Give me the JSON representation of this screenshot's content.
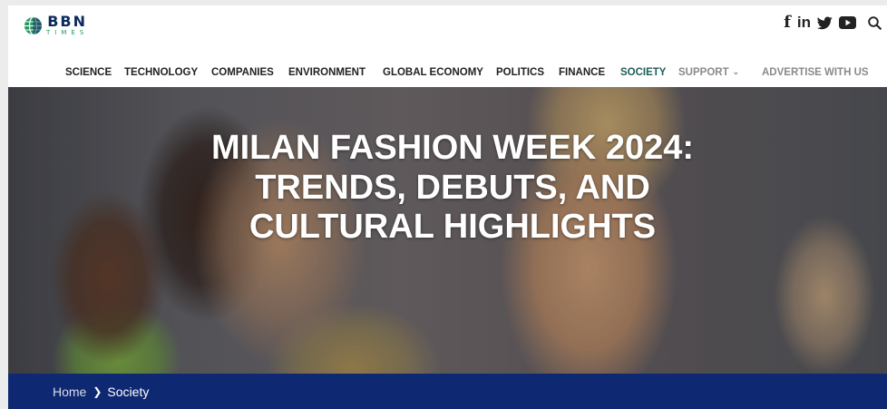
{
  "brand": {
    "logo_main": "BBN",
    "logo_sub": "TIMES",
    "colors": {
      "navy": "#0d2a5e",
      "green": "#1f9a5c"
    }
  },
  "social_icons": [
    "facebook-icon",
    "linkedin-icon",
    "twitter-icon",
    "youtube-icon",
    "search-icon"
  ],
  "social_glyphs": {
    "facebook": "f",
    "linkedin": "in"
  },
  "nav": {
    "items": [
      {
        "label": "SCIENCE"
      },
      {
        "label": "TECHNOLOGY"
      },
      {
        "label": "COMPANIES"
      },
      {
        "label": "ENVIRONMENT"
      },
      {
        "label": "GLOBAL ECONOMY"
      },
      {
        "label": "POLITICS"
      },
      {
        "label": "FINANCE"
      },
      {
        "label": "SOCIETY",
        "active": true
      },
      {
        "label": "SUPPORT",
        "has_dropdown": true
      },
      {
        "label": "ADVERTISE WITH US"
      }
    ],
    "active_color": "#1d5e58"
  },
  "hero": {
    "title": "MILAN FASHION WEEK 2024: TRENDS, DEBUTS, AND CULTURAL HIGHLIGHTS"
  },
  "breadcrumb": {
    "home": "Home",
    "current": "Society",
    "bar_color": "#0e2872"
  }
}
